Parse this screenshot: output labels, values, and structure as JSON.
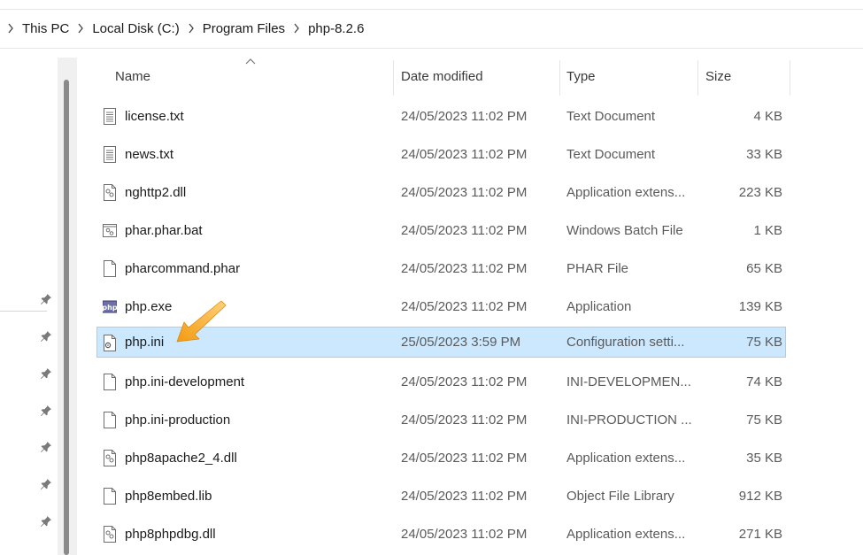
{
  "breadcrumb": {
    "items": [
      "This PC",
      "Local Disk (C:)",
      "Program Files",
      "php-8.2.6"
    ]
  },
  "columns": {
    "name": "Name",
    "date": "Date modified",
    "type": "Type",
    "size": "Size"
  },
  "files": [
    {
      "name": "license.txt",
      "date": "24/05/2023 11:02 PM",
      "type": "Text Document",
      "size": "4 KB",
      "icon": "text-file-icon"
    },
    {
      "name": "news.txt",
      "date": "24/05/2023 11:02 PM",
      "type": "Text Document",
      "size": "33 KB",
      "icon": "text-file-icon"
    },
    {
      "name": "nghttp2.dll",
      "date": "24/05/2023 11:02 PM",
      "type": "Application extens...",
      "size": "223 KB",
      "icon": "dll-file-icon"
    },
    {
      "name": "phar.phar.bat",
      "date": "24/05/2023 11:02 PM",
      "type": "Windows Batch File",
      "size": "1 KB",
      "icon": "batch-file-icon"
    },
    {
      "name": "pharcommand.phar",
      "date": "24/05/2023 11:02 PM",
      "type": "PHAR File",
      "size": "65 KB",
      "icon": "blank-file-icon"
    },
    {
      "name": "php.exe",
      "date": "24/05/2023 11:02 PM",
      "type": "Application",
      "size": "139 KB",
      "icon": "php-exe-icon"
    },
    {
      "name": "php.ini",
      "date": "25/05/2023 3:59 PM",
      "type": "Configuration setti...",
      "size": "75 KB",
      "icon": "config-file-icon",
      "selected": true
    },
    {
      "name": "php.ini-development",
      "date": "24/05/2023 11:02 PM",
      "type": "INI-DEVELOPMEN...",
      "size": "74 KB",
      "icon": "blank-file-icon"
    },
    {
      "name": "php.ini-production",
      "date": "24/05/2023 11:02 PM",
      "type": "INI-PRODUCTION ...",
      "size": "75 KB",
      "icon": "blank-file-icon"
    },
    {
      "name": "php8apache2_4.dll",
      "date": "24/05/2023 11:02 PM",
      "type": "Application extens...",
      "size": "35 KB",
      "icon": "dll-file-icon"
    },
    {
      "name": "php8embed.lib",
      "date": "24/05/2023 11:02 PM",
      "type": "Object File Library",
      "size": "912 KB",
      "icon": "blank-file-icon"
    },
    {
      "name": "php8phpdbg.dll",
      "date": "24/05/2023 11:02 PM",
      "type": "Application extens...",
      "size": "271 KB",
      "icon": "dll-file-icon"
    }
  ],
  "colors": {
    "selection_bg": "#cce8ff",
    "selection_border": "#99d1ff",
    "annotation_arrow": "#f5a623"
  }
}
